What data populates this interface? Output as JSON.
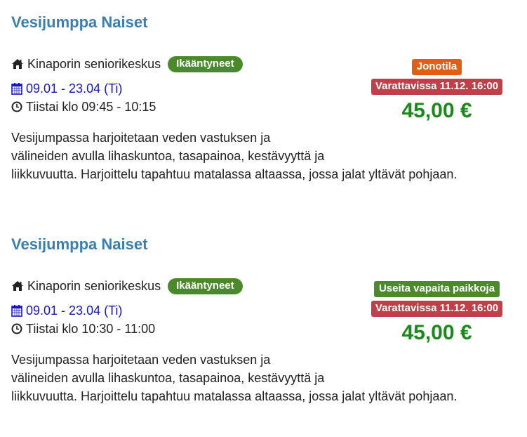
{
  "colors": {
    "title": "#3a7fb0",
    "category_badge": "#4a8a2a",
    "date_link": "#1515cc",
    "bookable_badge": "#c0404a",
    "price": "#1a8a1a",
    "status_queue": "#e35d12",
    "status_free": "#4a8a2a"
  },
  "courses": [
    {
      "title": "Vesijumppa Naiset",
      "location_icon": "home-icon",
      "location": "Kinaporin seniorikeskus",
      "category": "Ikääntyneet",
      "date_icon": "calendar-icon",
      "dates": "09.01 - 23.04 (Ti)",
      "time_icon": "clock-icon",
      "time": "Tiistai klo 09:45 - 10:15",
      "description_lines": [
        "Vesijumpassa harjoitetaan veden vastuksen ja",
        "välineiden avulla lihaskuntoa, tasapainoa, kestävyyttä ja",
        "liikkuvuutta. Harjoittelu tapahtuu matalassa altaassa, jossa jalat yltävät pohjaan."
      ],
      "status": "Jonotila",
      "status_color": "#e35d12",
      "bookable": "Varattavissa 11.12. 16:00",
      "price": "45,00 €"
    },
    {
      "title": "Vesijumppa Naiset",
      "location_icon": "home-icon",
      "location": "Kinaporin seniorikeskus",
      "category": "Ikääntyneet",
      "date_icon": "calendar-icon",
      "dates": "09.01 - 23.04 (Ti)",
      "time_icon": "clock-icon",
      "time": "Tiistai klo 10:30 - 11:00",
      "description_lines": [
        "Vesijumpassa harjoitetaan veden vastuksen ja",
        "välineiden avulla lihaskuntoa, tasapainoa, kestävyyttä ja",
        "liikkuvuutta. Harjoittelu tapahtuu matalassa altaassa, jossa jalat yltävät pohjaan."
      ],
      "status": "Useita vapaita paikkoja",
      "status_color": "#4a8a2a",
      "bookable": "Varattavissa 11.12. 16:00",
      "price": "45,00 €"
    }
  ]
}
